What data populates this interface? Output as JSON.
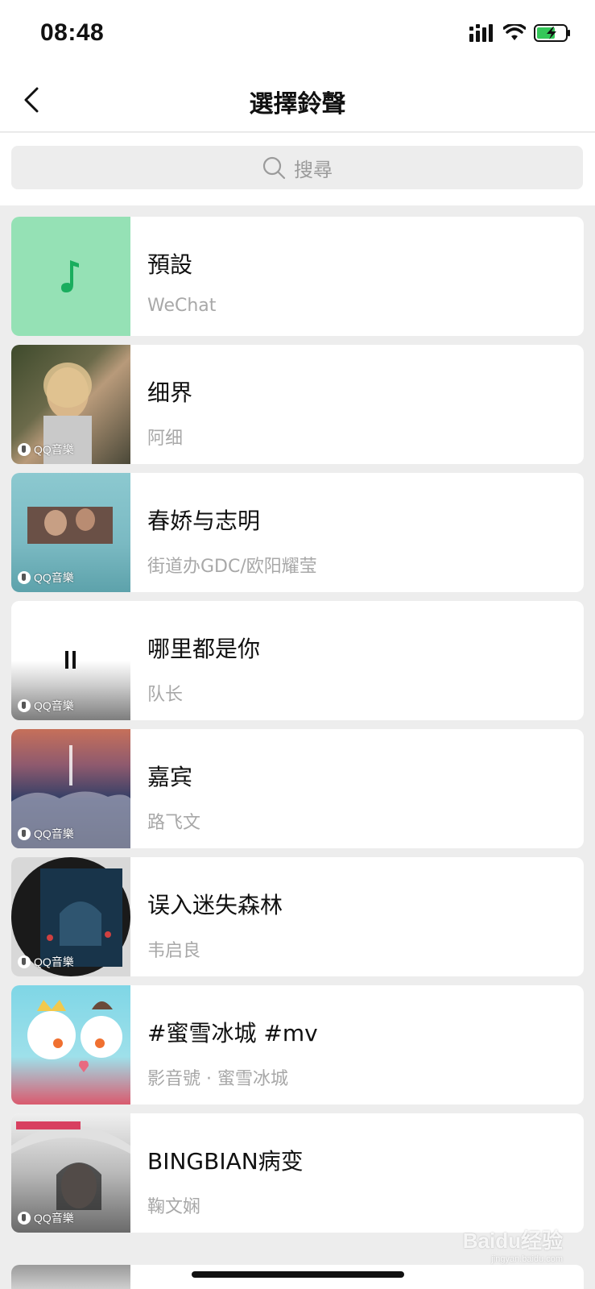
{
  "status_bar": {
    "time": "08:48",
    "icons": [
      "signal-icon",
      "wifi-icon",
      "battery-charging-icon"
    ]
  },
  "nav": {
    "title": "選擇鈴聲",
    "back_icon": "chevron-left-icon"
  },
  "search": {
    "placeholder": "搜尋",
    "icon": "search-icon"
  },
  "ringtones": [
    {
      "title": "預設",
      "subtitle": "WeChat",
      "thumb": "music-note",
      "badge": ""
    },
    {
      "title": "细界",
      "subtitle": "阿细",
      "thumb": "album-photo",
      "badge": "QQ音樂"
    },
    {
      "title": "春娇与志明",
      "subtitle": "街道办GDC/欧阳耀莹",
      "thumb": "album-photo",
      "badge": "QQ音樂"
    },
    {
      "title": "哪里都是你",
      "subtitle": "队长",
      "thumb": "pause",
      "badge": "QQ音樂"
    },
    {
      "title": "嘉宾",
      "subtitle": "路飞文",
      "thumb": "album-photo",
      "badge": "QQ音樂"
    },
    {
      "title": "误入迷失森林",
      "subtitle": "韦启良",
      "thumb": "album-photo",
      "badge": "QQ音樂"
    },
    {
      "title": "#蜜雪冰城 #mv",
      "subtitle": "影音號 · 蜜雪冰城",
      "thumb": "album-photo",
      "badge": ""
    },
    {
      "title": "BINGBIAN病变",
      "subtitle": "鞠文娴",
      "thumb": "album-photo",
      "badge": "QQ音樂"
    }
  ],
  "colors": {
    "accent": "#07c160",
    "default_thumb_bg": "#95e1b5"
  },
  "watermark": {
    "brand": "Baidu经验",
    "url": "jingyan.baidu.com"
  }
}
